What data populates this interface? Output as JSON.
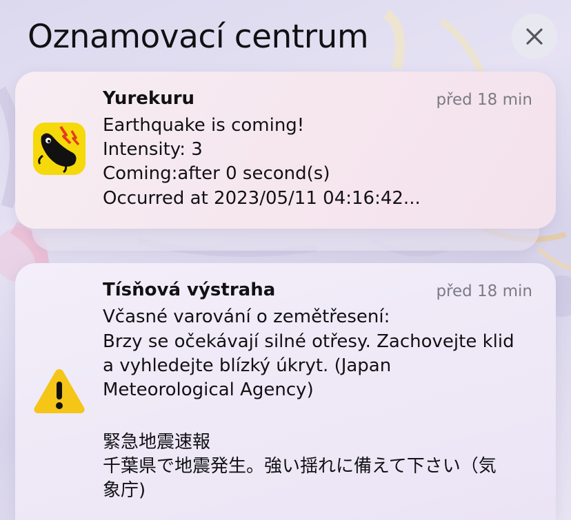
{
  "header": {
    "title": "Oznamovací centrum",
    "close_icon": "xmark-icon"
  },
  "notifications": [
    {
      "app": "Yurekuru",
      "time": "před 18 min",
      "icon": "yurekuru-catfish-icon",
      "icon_color": "#f5d90a",
      "lines": [
        "Earthquake is coming!",
        "Intensity: 3",
        "Coming:after 0 second(s)",
        "Occurred at 2023/05/11 04:16:42..."
      ]
    },
    {
      "app": "Tísňová výstraha",
      "time": "před 18 min",
      "icon": "warning-triangle-icon",
      "icon_color": "#f5c518",
      "lines": [
        "Včasné varování o zemětřesení:",
        "Brzy se očekávají silné otřesy. Zachovejte klid",
        "a vyhledejte blízký úkryt. (Japan",
        "Meteorological Agency)",
        "",
        "緊急地震速報",
        "千葉県で地震発生。強い揺れに備えて下さい（気",
        "象庁)"
      ]
    }
  ]
}
